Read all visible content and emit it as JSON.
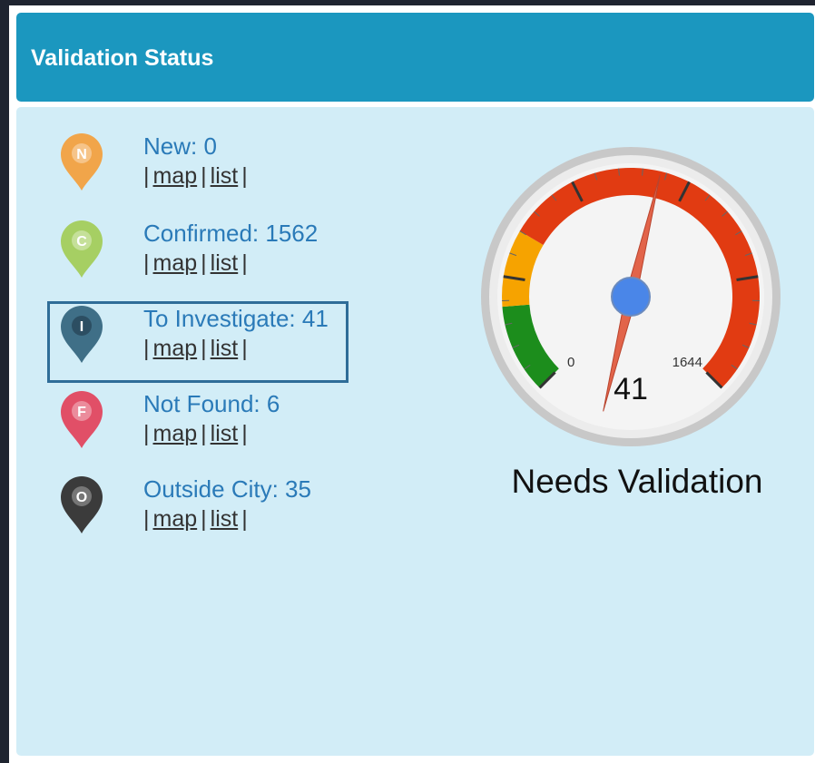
{
  "panel": {
    "title": "Validation Status"
  },
  "statuses": [
    {
      "letter": "N",
      "label": "New: 0",
      "color": "#f1a54a",
      "map": "map",
      "list": "list"
    },
    {
      "letter": "C",
      "label": "Confirmed: 1562",
      "color": "#a6cf63",
      "map": "map",
      "list": "list"
    },
    {
      "letter": "I",
      "label": "To Investigate: 41",
      "color": "#3f6f87",
      "map": "map",
      "list": "list"
    },
    {
      "letter": "F",
      "label": "Not Found: 6",
      "color": "#e14f67",
      "map": "map",
      "list": "list"
    },
    {
      "letter": "O",
      "label": "Outside City: 35",
      "color": "#3b3b3b",
      "map": "map",
      "list": "list"
    }
  ],
  "gauge": {
    "min_label": "0",
    "max_label": "1644",
    "value_label": "41",
    "caption": "Needs Validation",
    "value": 41,
    "min": 0,
    "max": 1644,
    "zone_colors": {
      "green": "#1c8d1c",
      "orange": "#f6a300",
      "red": "#e13b12"
    }
  }
}
